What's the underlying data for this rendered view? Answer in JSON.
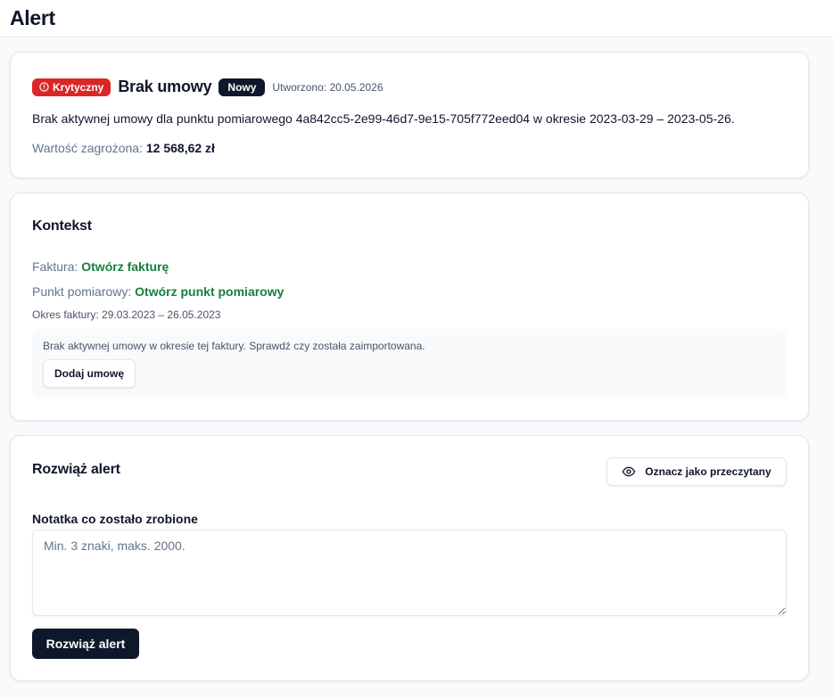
{
  "page": {
    "title": "Alert"
  },
  "alert": {
    "severity_label": "Krytyczny",
    "title": "Brak umowy",
    "status_label": "Nowy",
    "created": "Utworzono: 20.05.2026",
    "description": "Brak aktywnej umowy dla punktu pomiarowego 4a842cc5-2e99-46d7-9e15-705f772eed04 w okresie 2023-03-29 – 2023-05-26.",
    "value_label": "Wartość zagrożona:",
    "value_amount": "12 568,62 zł",
    "colors": {
      "critical": "#dc2626",
      "new": "#0f172a"
    }
  },
  "context": {
    "title": "Kontekst",
    "invoice_label": "Faktura:",
    "invoice_link": "Otwórz fakturę",
    "meter_label": "Punkt pomiarowy:",
    "meter_link": "Otwórz punkt pomiarowy",
    "period": "Okres faktury: 29.03.2023 – 26.05.2023",
    "hint": "Brak aktywnej umowy w okresie tej faktury. Sprawdź czy została zaimportowana.",
    "add_contract_button": "Dodaj umowę",
    "link_color": "#15803d"
  },
  "resolve": {
    "title": "Rozwiąż alert",
    "mark_read_button": "Oznacz jako przeczytany",
    "note_label": "Notatka co zostało zrobione",
    "note_value": "",
    "note_placeholder": "Min. 3 znaki, maks. 2000.",
    "resolve_button": "Rozwiąż alert"
  },
  "icons": {
    "severity": "alert-circle-icon",
    "mark_read": "eye-icon",
    "resize": "resize-handle-icon"
  }
}
